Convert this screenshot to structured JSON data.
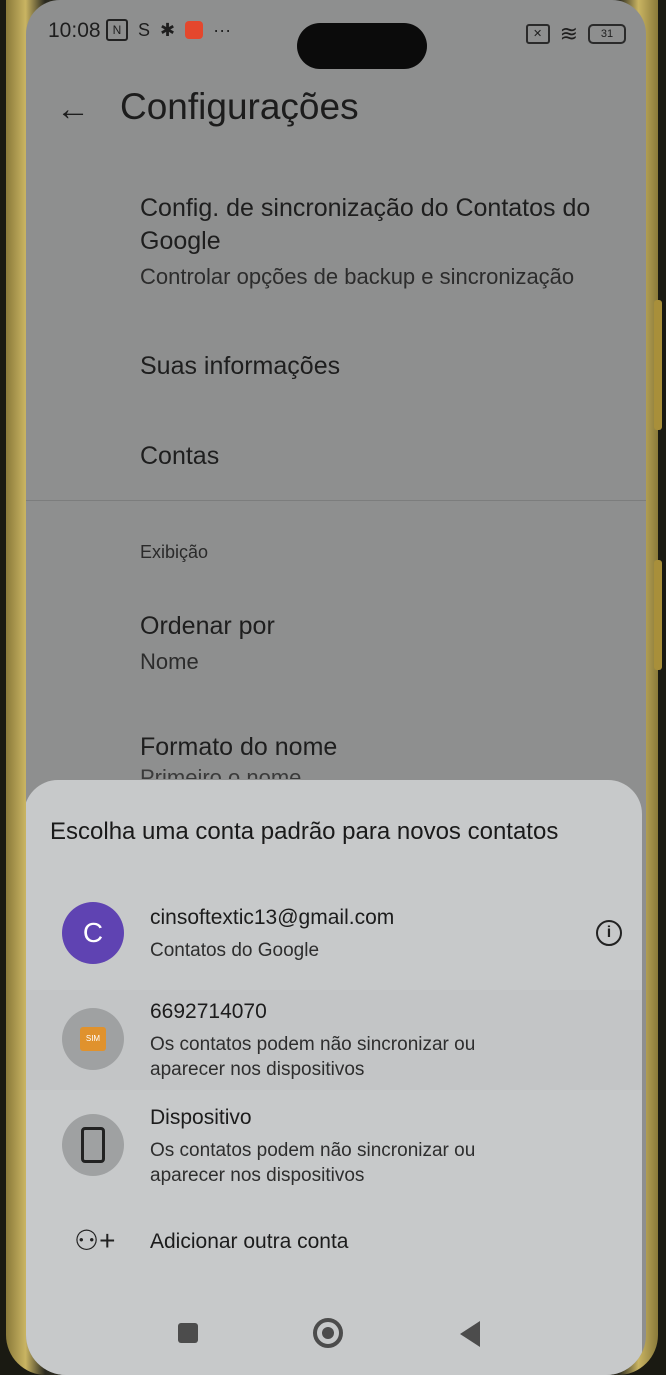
{
  "status_bar": {
    "time": "10:08",
    "battery": "31",
    "nfc_glyph": "N",
    "sim_glyph": "S",
    "gear_glyph": "✱",
    "more_glyph": "···",
    "wifi_glyph": "≋",
    "x_glyph": "✕"
  },
  "header": {
    "title": "Configurações",
    "back_icon": "←"
  },
  "settings": {
    "sync": {
      "title": "Config. de sincronização do Contatos do Google",
      "subtitle": "Controlar opções de backup e sincronização"
    },
    "info": {
      "title": "Suas informações"
    },
    "accounts": {
      "title": "Contas"
    },
    "section_display": "Exibição",
    "sort": {
      "title": "Ordenar por",
      "value": "Nome"
    },
    "name_format": {
      "title": "Formato do nome",
      "value": "Primeiro o nome"
    }
  },
  "sheet": {
    "title": "Escolha uma conta padrão para novos contatos",
    "accounts": [
      {
        "avatar_letter": "C",
        "title": "cinsoftextic13@gmail.com",
        "subtitle": "Contatos do Google",
        "icon": "person-avatar"
      },
      {
        "title": "6692714070",
        "subtitle": "Os contatos podem não sincronizar ou aparecer nos dispositivos",
        "icon": "sim-card-icon",
        "icon_text": "SIM"
      },
      {
        "title": "Dispositivo",
        "subtitle": "Os contatos podem não sincronizar ou aparecer nos dispositivos",
        "icon": "phone-device-icon"
      }
    ],
    "add_account": "Adicionar outra conta",
    "info_glyph": "i",
    "add_glyph": "⚇+"
  },
  "colors": {
    "scrim": "#8e8f8f",
    "sheet": "#c7c9ca",
    "avatar": "#5f43b2",
    "sim": "#e0922d"
  }
}
